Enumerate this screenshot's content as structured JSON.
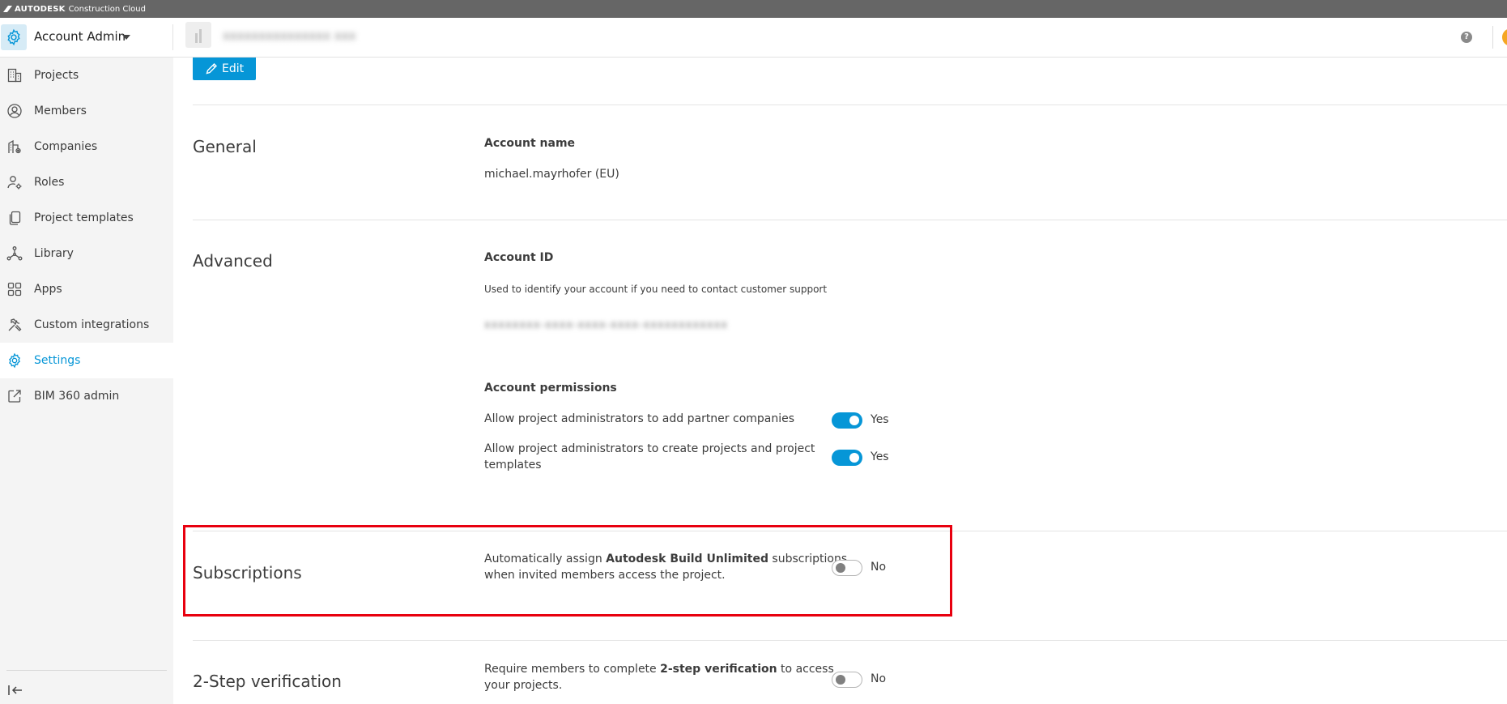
{
  "brand": {
    "name_strong": "AUTODESK",
    "name_light": "Construction Cloud"
  },
  "header": {
    "app_title": "Account Admin",
    "project_name": "xxxxxxxxxxxxxxx xxx",
    "help_label": "?"
  },
  "sidebar": {
    "items": [
      {
        "label": "Projects",
        "icon": "building-icon"
      },
      {
        "label": "Members",
        "icon": "user-circle-icon"
      },
      {
        "label": "Companies",
        "icon": "company-icon"
      },
      {
        "label": "Roles",
        "icon": "user-gear-icon"
      },
      {
        "label": "Project templates",
        "icon": "copy-icon"
      },
      {
        "label": "Library",
        "icon": "network-icon"
      },
      {
        "label": "Apps",
        "icon": "grid-icon"
      },
      {
        "label": "Custom integrations",
        "icon": "tools-icon"
      },
      {
        "label": "Settings",
        "icon": "gear-icon",
        "active": true
      },
      {
        "label": "BIM 360 admin",
        "icon": "external-link-icon"
      }
    ]
  },
  "main": {
    "edit_label": "Edit",
    "general": {
      "title": "General",
      "account_name_label": "Account name",
      "account_name_value": "michael.mayrhofer (EU)"
    },
    "advanced": {
      "title": "Advanced",
      "account_id_label": "Account ID",
      "account_id_help": "Used to identify your account if you need to contact customer support",
      "account_id_value": "xxxxxxxx-xxxx-xxxx-xxxx-xxxxxxxxxxxx",
      "permissions_label": "Account permissions",
      "permissions": [
        {
          "text": "Allow project administrators to add partner companies",
          "state": "Yes",
          "on": true
        },
        {
          "line1": "Allow project administrators to create projects and project",
          "line2": "templates",
          "state": "Yes",
          "on": true
        }
      ]
    },
    "subscriptions": {
      "title": "Subscriptions",
      "text_pre": "Automatically assign ",
      "text_bold": "Autodesk Build Unlimited",
      "text_post": " subscriptions",
      "text_line2": "when invited members access the project.",
      "state": "No",
      "on": false
    },
    "two_step": {
      "title": "2-Step verification",
      "text_pre": "Require members to complete ",
      "text_bold": "2-step verification",
      "text_post": " to access",
      "text_line2": "your projects.",
      "state": "No",
      "on": false
    }
  },
  "colors": {
    "accent": "#0696d7",
    "brand_bar": "#666666",
    "sidebar_bg": "#f4f4f4",
    "highlight": "#e8000f"
  }
}
